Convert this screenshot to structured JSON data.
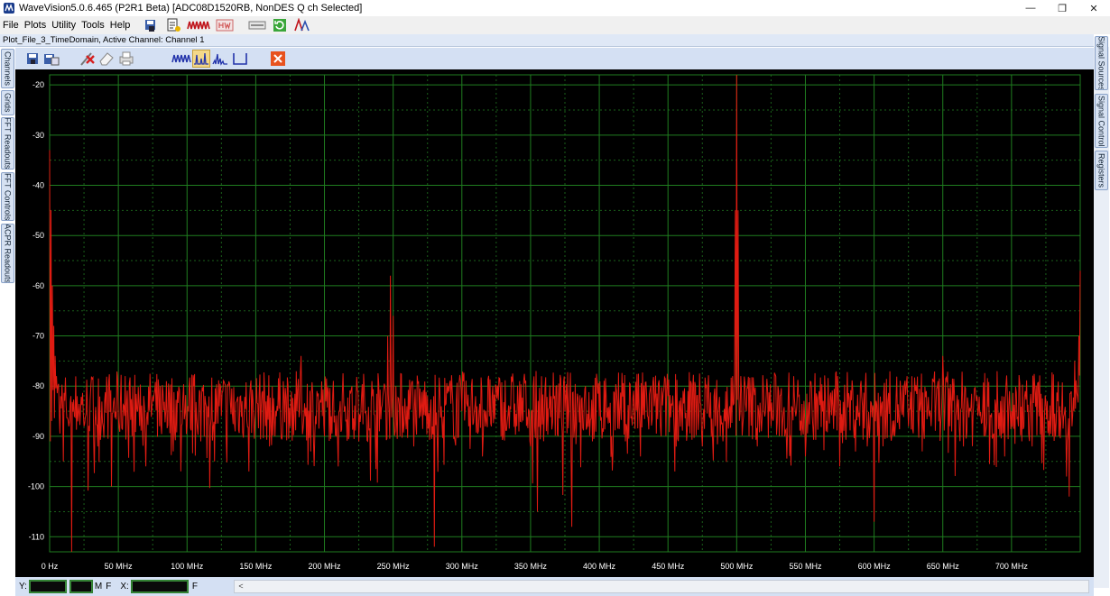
{
  "window": {
    "title": "WaveVision5.0.6.465 (P2R1 Beta)  [ADC08D1520RB, NonDES Q ch Selected]",
    "minimize_glyph": "—",
    "restore_glyph": "❐",
    "close_glyph": "✕"
  },
  "menu": [
    {
      "key": "file",
      "label": "File"
    },
    {
      "key": "plots",
      "label": "Plots"
    },
    {
      "key": "utility",
      "label": "Utility"
    },
    {
      "key": "tools",
      "label": "Tools"
    },
    {
      "key": "help",
      "label": "Help"
    }
  ],
  "plot_header": "Plot_File_3_TimeDomain,  Active Channel: Channel 1",
  "left_tabs": [
    "Channels",
    "Grids",
    "FFT Readouts",
    "FFT Controls",
    "ACPR Readouts"
  ],
  "right_tabs": [
    "Signal Sources",
    "Signal Control",
    "Registers"
  ],
  "status": {
    "y_label": "Y:",
    "m_label": "M",
    "f_label": "F",
    "x_label": "X:",
    "f2_label": "F",
    "scroll_left_glyph": "<"
  },
  "colors": {
    "trace": "#e01b12",
    "grid_major": "#1f7d1f",
    "grid_minor": "#1a5f1a",
    "plot_bg": "#000000",
    "axis_text": "#ffffff"
  },
  "chart_data": {
    "type": "line",
    "title": "",
    "xlabel": "",
    "ylabel": "",
    "x_unit": "MHz",
    "xlim": [
      0,
      750
    ],
    "ylim": [
      -113,
      -18
    ],
    "x_ticks": [
      "0 Hz",
      "50 MHz",
      "100 MHz",
      "150 MHz",
      "200 MHz",
      "250 MHz",
      "300 MHz",
      "350 MHz",
      "400 MHz",
      "450 MHz",
      "500 MHz",
      "550 MHz",
      "600 MHz",
      "650 MHz",
      "700 MHz"
    ],
    "x_tick_values": [
      0,
      50,
      100,
      150,
      200,
      250,
      300,
      350,
      400,
      450,
      500,
      550,
      600,
      650,
      700
    ],
    "y_ticks": [
      "-20",
      "-30",
      "-40",
      "-50",
      "-60",
      "-70",
      "-80",
      "-90",
      "-100",
      "-110"
    ],
    "y_tick_values": [
      -20,
      -30,
      -40,
      -50,
      -60,
      -70,
      -80,
      -90,
      -100,
      -110
    ],
    "grid": true,
    "noise_floor": -84,
    "series": [
      {
        "points": [
          [
            0,
            -33
          ],
          [
            1,
            -45
          ],
          [
            2,
            -60
          ],
          [
            3,
            -68
          ],
          [
            4,
            -74
          ],
          [
            5,
            -78
          ],
          [
            6,
            -80
          ],
          [
            8,
            -82
          ],
          [
            10,
            -95
          ],
          [
            12,
            -84
          ],
          [
            14,
            -88
          ],
          [
            16,
            -113
          ],
          [
            18,
            -86
          ],
          [
            20,
            -82
          ],
          [
            25,
            -88
          ],
          [
            30,
            -80
          ],
          [
            35,
            -92
          ],
          [
            40,
            -83
          ],
          [
            45,
            -100
          ],
          [
            50,
            -86
          ],
          [
            55,
            -78
          ],
          [
            60,
            -90
          ],
          [
            65,
            -84
          ],
          [
            70,
            -96
          ],
          [
            75,
            -82
          ],
          [
            80,
            -88
          ],
          [
            85,
            -79
          ],
          [
            90,
            -93
          ],
          [
            95,
            -85
          ],
          [
            100,
            -88
          ],
          [
            105,
            -80
          ],
          [
            110,
            -91
          ],
          [
            115,
            -84
          ],
          [
            120,
            -95
          ],
          [
            125,
            -86
          ],
          [
            130,
            -80
          ],
          [
            135,
            -89
          ],
          [
            140,
            -83
          ],
          [
            145,
            -97
          ],
          [
            150,
            -85
          ],
          [
            155,
            -81
          ],
          [
            160,
            -92
          ],
          [
            165,
            -86
          ],
          [
            170,
            -79
          ],
          [
            175,
            -88
          ],
          [
            180,
            -85
          ],
          [
            183,
            -74
          ],
          [
            186,
            -86
          ],
          [
            190,
            -93
          ],
          [
            195,
            -82
          ],
          [
            200,
            -90
          ],
          [
            205,
            -86
          ],
          [
            210,
            -96
          ],
          [
            215,
            -84
          ],
          [
            220,
            -80
          ],
          [
            225,
            -91
          ],
          [
            230,
            -85
          ],
          [
            235,
            -82
          ],
          [
            240,
            -89
          ],
          [
            244,
            -80
          ],
          [
            246,
            -70
          ],
          [
            248,
            -58
          ],
          [
            250,
            -66
          ],
          [
            252,
            -80
          ],
          [
            255,
            -90
          ],
          [
            260,
            -84
          ],
          [
            265,
            -92
          ],
          [
            270,
            -86
          ],
          [
            275,
            -82
          ],
          [
            280,
            -112
          ],
          [
            282,
            -90
          ],
          [
            285,
            -84
          ],
          [
            290,
            -80
          ],
          [
            295,
            -91
          ],
          [
            300,
            -85
          ],
          [
            305,
            -88
          ],
          [
            310,
            -82
          ],
          [
            315,
            -94
          ],
          [
            320,
            -86
          ],
          [
            325,
            -80
          ],
          [
            330,
            -90
          ],
          [
            335,
            -84
          ],
          [
            340,
            -88
          ],
          [
            345,
            -79
          ],
          [
            350,
            -92
          ],
          [
            355,
            -105
          ],
          [
            360,
            -86
          ],
          [
            365,
            -82
          ],
          [
            370,
            -90
          ],
          [
            375,
            -85
          ],
          [
            380,
            -108
          ],
          [
            385,
            -84
          ],
          [
            390,
            -80
          ],
          [
            395,
            -91
          ],
          [
            400,
            -86
          ],
          [
            405,
            -82
          ],
          [
            410,
            -93
          ],
          [
            415,
            -85
          ],
          [
            420,
            -88
          ],
          [
            425,
            -81
          ],
          [
            430,
            -94
          ],
          [
            435,
            -86
          ],
          [
            440,
            -84
          ],
          [
            445,
            -90
          ],
          [
            450,
            -82
          ],
          [
            455,
            -97
          ],
          [
            460,
            -85
          ],
          [
            465,
            -88
          ],
          [
            470,
            -80
          ],
          [
            475,
            -92
          ],
          [
            480,
            -86
          ],
          [
            485,
            -83
          ],
          [
            490,
            -91
          ],
          [
            495,
            -84
          ],
          [
            497,
            -78
          ],
          [
            499,
            -45
          ],
          [
            500,
            -18
          ],
          [
            501,
            -45
          ],
          [
            503,
            -78
          ],
          [
            505,
            -86
          ],
          [
            510,
            -82
          ],
          [
            515,
            -92
          ],
          [
            520,
            -85
          ],
          [
            525,
            -88
          ],
          [
            530,
            -80
          ],
          [
            535,
            -90
          ],
          [
            540,
            -84
          ],
          [
            545,
            -82
          ],
          [
            550,
            -94
          ],
          [
            555,
            -86
          ],
          [
            560,
            -81
          ],
          [
            565,
            -89
          ],
          [
            570,
            -84
          ],
          [
            575,
            -96
          ],
          [
            580,
            -85
          ],
          [
            585,
            -88
          ],
          [
            590,
            -80
          ],
          [
            595,
            -92
          ],
          [
            600,
            -107
          ],
          [
            605,
            -86
          ],
          [
            610,
            -83
          ],
          [
            615,
            -90
          ],
          [
            620,
            -85
          ],
          [
            625,
            -88
          ],
          [
            630,
            -81
          ],
          [
            635,
            -93
          ],
          [
            640,
            -86
          ],
          [
            645,
            -84
          ],
          [
            650,
            -74
          ],
          [
            655,
            -88
          ],
          [
            660,
            -84
          ],
          [
            665,
            -92
          ],
          [
            670,
            -85
          ],
          [
            675,
            -82
          ],
          [
            680,
            -90
          ],
          [
            685,
            -86
          ],
          [
            690,
            -83
          ],
          [
            695,
            -94
          ],
          [
            700,
            -85
          ],
          [
            705,
            -88
          ],
          [
            710,
            -81
          ],
          [
            715,
            -92
          ],
          [
            720,
            -86
          ],
          [
            725,
            -83
          ],
          [
            730,
            -90
          ],
          [
            735,
            -84
          ],
          [
            740,
            -98
          ],
          [
            742,
            -102
          ],
          [
            744,
            -88
          ],
          [
            746,
            -75
          ],
          [
            748,
            -82
          ],
          [
            749,
            -70
          ],
          [
            750,
            -57
          ]
        ]
      }
    ]
  }
}
